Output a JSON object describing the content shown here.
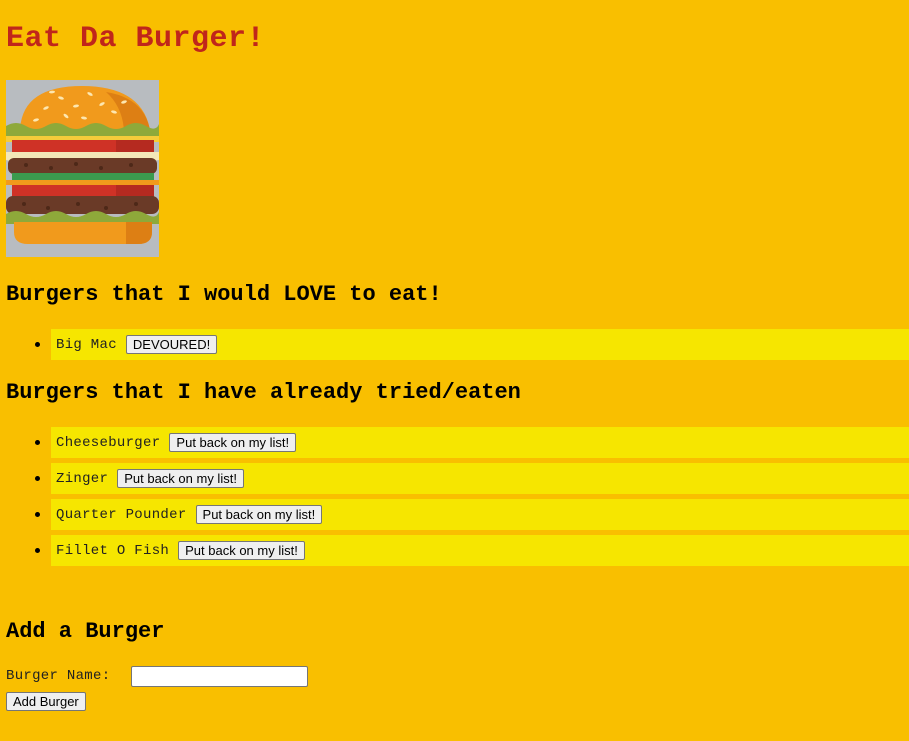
{
  "header": {
    "title": "Eat Da Burger!",
    "title_color": "#c0261b"
  },
  "logo": {
    "icon": "burger-icon"
  },
  "to_eat": {
    "heading": "Burgers that I would LOVE to eat!",
    "items": [
      {
        "name": "Big Mac",
        "button": "DEVOURED!"
      }
    ]
  },
  "eaten": {
    "heading": "Burgers that I have already tried/eaten",
    "items": [
      {
        "name": "Cheeseburger",
        "button": "Put back on my list!"
      },
      {
        "name": "Zinger",
        "button": "Put back on my list!"
      },
      {
        "name": "Quarter Pounder",
        "button": "Put back on my list!"
      },
      {
        "name": "Fillet O Fish",
        "button": "Put back on my list!"
      }
    ]
  },
  "add_form": {
    "heading": "Add a Burger",
    "label": "Burger Name:",
    "input_value": "",
    "submit_label": "Add Burger"
  },
  "colors": {
    "background": "#f9bf00",
    "item_background": "#f6e600"
  }
}
